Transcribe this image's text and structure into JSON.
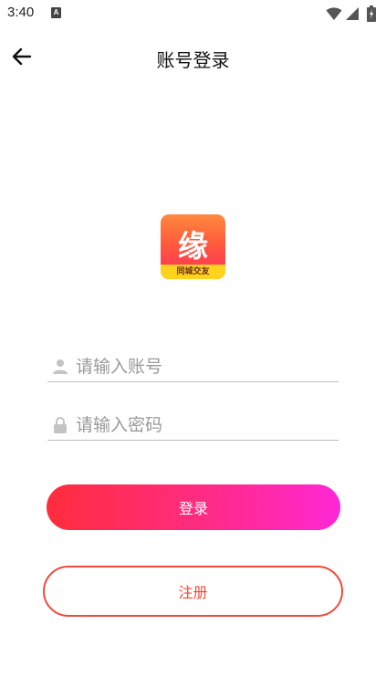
{
  "status_bar": {
    "time": "3:40",
    "notification_badge": "A",
    "icons": [
      "wifi-icon",
      "signal-icon",
      "battery-icon"
    ]
  },
  "header": {
    "title": "账号登录",
    "back_icon": "arrow-left-icon"
  },
  "logo": {
    "character": "缘",
    "tagline": "同城交友"
  },
  "form": {
    "account": {
      "placeholder": "请输入账号",
      "value": "",
      "icon": "user-icon"
    },
    "password": {
      "placeholder": "请输入密码",
      "value": "",
      "icon": "lock-icon"
    }
  },
  "actions": {
    "login_label": "登录",
    "register_label": "注册"
  },
  "colors": {
    "login_gradient": [
      "#ff2d3c",
      "#ff27d6"
    ],
    "register_accent": "#f04a3a",
    "logo_band": "#ffd21e"
  }
}
